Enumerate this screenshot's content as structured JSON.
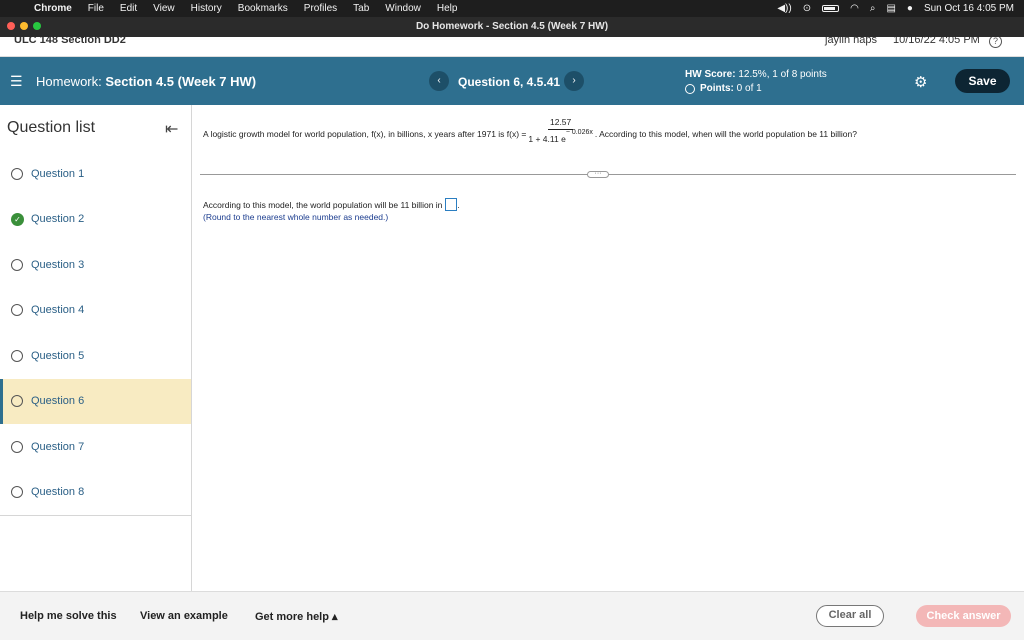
{
  "menubar": {
    "app": "Chrome",
    "items": [
      "File",
      "Edit",
      "View",
      "History",
      "Bookmarks",
      "Profiles",
      "Tab",
      "Window",
      "Help"
    ],
    "clock": "Sun Oct 16  4:05 PM"
  },
  "window": {
    "title": "Do Homework - Section 4.5 (Week 7 HW)",
    "lights": [
      "#ff5f57",
      "#febc2e",
      "#28c840"
    ]
  },
  "background_page": {
    "course": "ULC 148 Section DD2",
    "user": "jaylin haps",
    "datetime": "10/16/22 4:05 PM"
  },
  "header": {
    "hw_prefix": "Homework:",
    "hw_title": "Section 4.5 (Week 7 HW)",
    "question_label": "Question 6, 4.5.41",
    "hw_score_label": "HW Score:",
    "hw_score_value": "12.5%, 1 of 8 points",
    "points_label": "Points:",
    "points_value": "0 of 1",
    "save_label": "Save",
    "color": "#2e6f8f"
  },
  "sidebar": {
    "title": "Question list",
    "items": [
      {
        "label": "Question 1",
        "status": "open"
      },
      {
        "label": "Question 2",
        "status": "done"
      },
      {
        "label": "Question 3",
        "status": "open"
      },
      {
        "label": "Question 4",
        "status": "open"
      },
      {
        "label": "Question 5",
        "status": "open"
      },
      {
        "label": "Question 6",
        "status": "active"
      },
      {
        "label": "Question 7",
        "status": "open"
      },
      {
        "label": "Question 8",
        "status": "open"
      }
    ]
  },
  "question": {
    "prompt_start": "A logistic growth model for world population, f(x), in billions, x years after 1971 is f(x) =",
    "numerator": "12.57",
    "denominator_base": "1 + 4.11 e",
    "denominator_exp": "− 0.026x",
    "prompt_end": ". According to this model, when will the world population be 11 billion?",
    "answer_text": "According to this model, the world population will be 11 billion in",
    "answer_end": ".",
    "hint": "(Round to the nearest whole number as needed.)"
  },
  "footer": {
    "help_solve": "Help me solve this",
    "example": "View an example",
    "more_help": "Get more help ▴",
    "clear_all": "Clear all",
    "check_answer": "Check answer"
  }
}
